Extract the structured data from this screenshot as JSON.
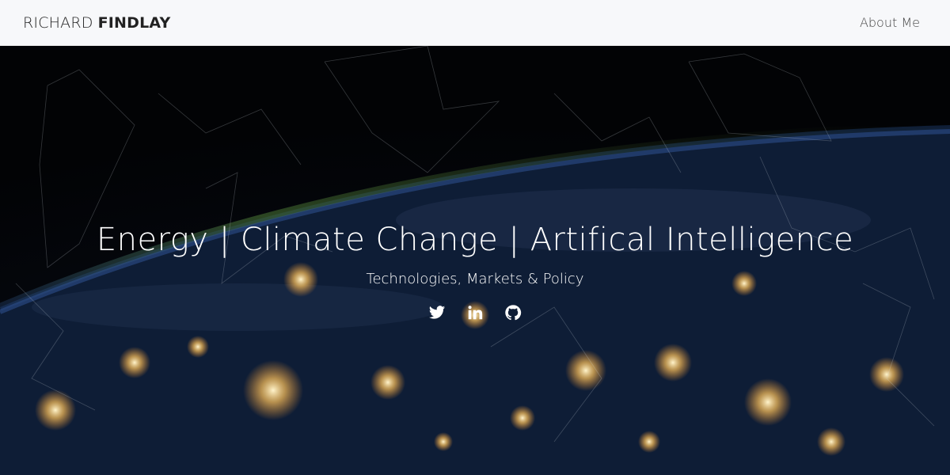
{
  "navbar": {
    "brand_first": "RICHARD",
    "brand_last": "FINDLAY",
    "about_link": "About Me"
  },
  "hero": {
    "headline": "Energy | Climate Change | Artifical Intelligence",
    "subheadline": "Technologies, Markets & Policy",
    "socials": [
      {
        "icon": "twitter-icon"
      },
      {
        "icon": "linkedin-icon"
      },
      {
        "icon": "github-icon"
      }
    ]
  },
  "colors": {
    "navbar_bg": "#f7f8fa",
    "text_dark": "#222222",
    "hero_text": "#ffffff",
    "city_lights": "#ffd27a",
    "atmosphere": "#3b6a2a"
  }
}
